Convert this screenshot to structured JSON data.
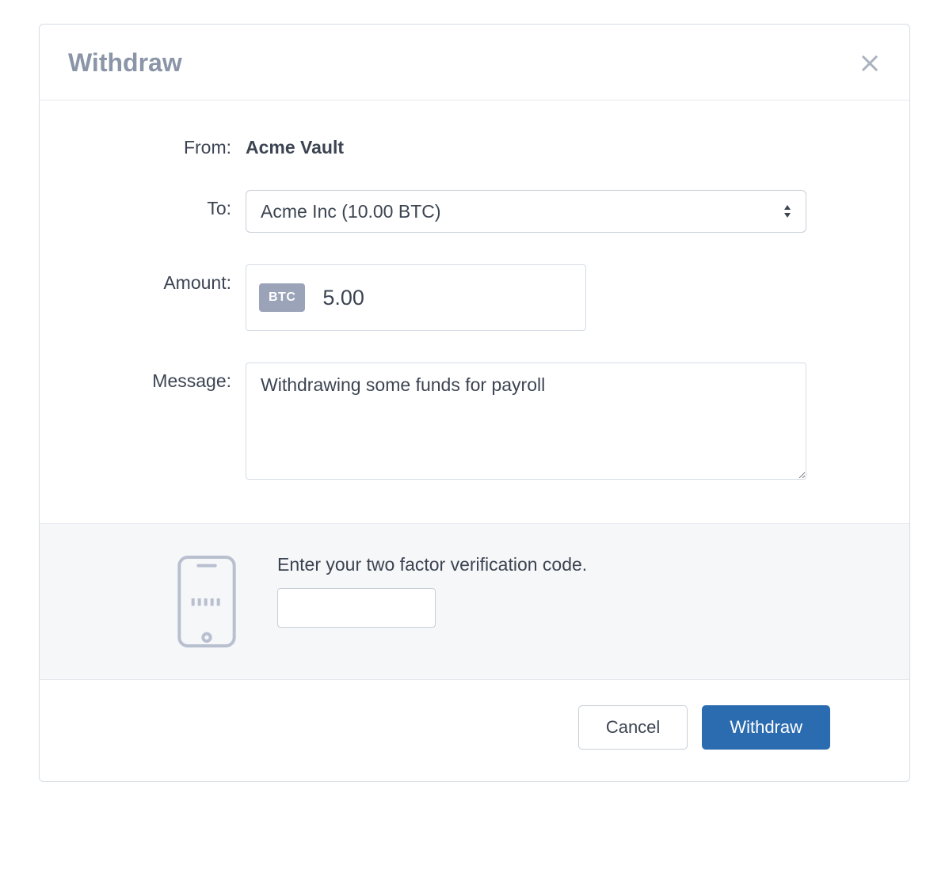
{
  "modal": {
    "title": "Withdraw"
  },
  "form": {
    "from_label": "From:",
    "from_value": "Acme Vault",
    "to_label": "To:",
    "to_selected": "Acme Inc (10.00 BTC)",
    "amount_label": "Amount:",
    "amount_currency": "BTC",
    "amount_value": "5.00",
    "message_label": "Message:",
    "message_value": "Withdrawing some funds for payroll"
  },
  "twofa": {
    "label": "Enter your two factor verification code.",
    "value": ""
  },
  "footer": {
    "cancel_label": "Cancel",
    "submit_label": "Withdraw"
  }
}
